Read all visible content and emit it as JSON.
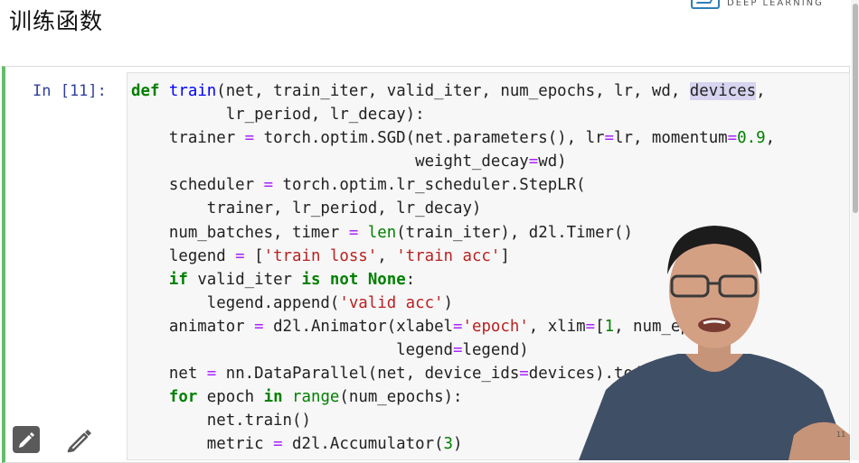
{
  "page": {
    "heading": "训练函数",
    "logo_text": "DEEP LEARNING"
  },
  "cell": {
    "prompt": "In [11]:",
    "code_lines": [
      "def train(net, train_iter, valid_iter, num_epochs, lr, wd, devices,",
      "          lr_period, lr_decay):",
      "    trainer = torch.optim.SGD(net.parameters(), lr=lr, momentum=0.9,",
      "                              weight_decay=wd)",
      "    scheduler = torch.optim.lr_scheduler.StepLR(",
      "        trainer, lr_period, lr_decay)",
      "    num_batches, timer = len(train_iter), d2l.Timer()",
      "    legend = ['train loss', 'train acc']",
      "    if valid_iter is not None:",
      "        legend.append('valid acc')",
      "    animator = d2l.Animator(xlabel='epoch', xlim=[1, num_epochs],",
      "                            legend=legend)",
      "    net = nn.DataParallel(net, device_ids=devices).to(devices[0])",
      "    for epoch in range(num_epochs):",
      "        net.train()",
      "        metric = d2l.Accumulator(3)"
    ]
  },
  "slide_number": "11",
  "icons": [
    "edit-icon",
    "pencil-icon",
    "logo-icon"
  ],
  "colors": {
    "cell_border": "#66bb6a",
    "keyword": "#008000",
    "function_name": "#0000ff",
    "string": "#ba2121",
    "operator": "#aa22ff",
    "prompt": "#303f9f"
  }
}
